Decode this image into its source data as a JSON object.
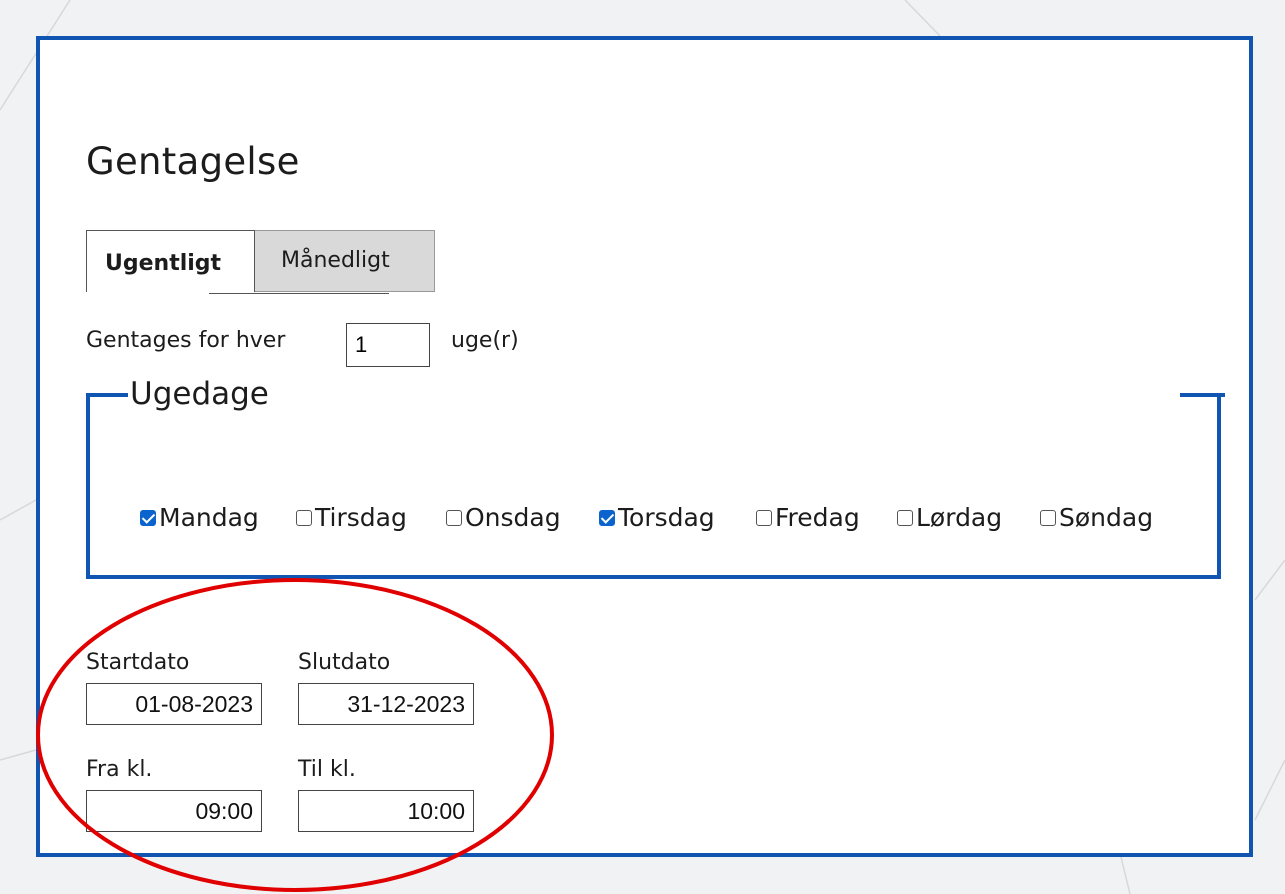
{
  "dialog": {
    "title": "Gentagelse",
    "tabs": [
      {
        "label": "Ugentligt",
        "active": true
      },
      {
        "label": "Månedligt",
        "active": false
      }
    ],
    "repeat": {
      "prefix": "Gentages for hver",
      "value": "1",
      "unit": "uge(r)"
    },
    "weekdays": {
      "legend": "Ugedage",
      "days": [
        {
          "label": "Mandag",
          "checked": true
        },
        {
          "label": "Tirsdag",
          "checked": false
        },
        {
          "label": "Onsdag",
          "checked": false
        },
        {
          "label": "Torsdag",
          "checked": true
        },
        {
          "label": "Fredag",
          "checked": false
        },
        {
          "label": "Lørdag",
          "checked": false
        },
        {
          "label": "Søndag",
          "checked": false
        }
      ]
    },
    "dates": {
      "start_label": "Startdato",
      "start_value": "01-08-2023",
      "end_label": "Slutdato",
      "end_value": "31-12-2023"
    },
    "times": {
      "from_label": "Fra kl.",
      "from_value": "09:00",
      "to_label": "Til kl.",
      "to_value": "10:00"
    }
  },
  "colors": {
    "accent": "#1155b3",
    "checkbox": "#0b63ce",
    "highlight": "#e00000"
  }
}
